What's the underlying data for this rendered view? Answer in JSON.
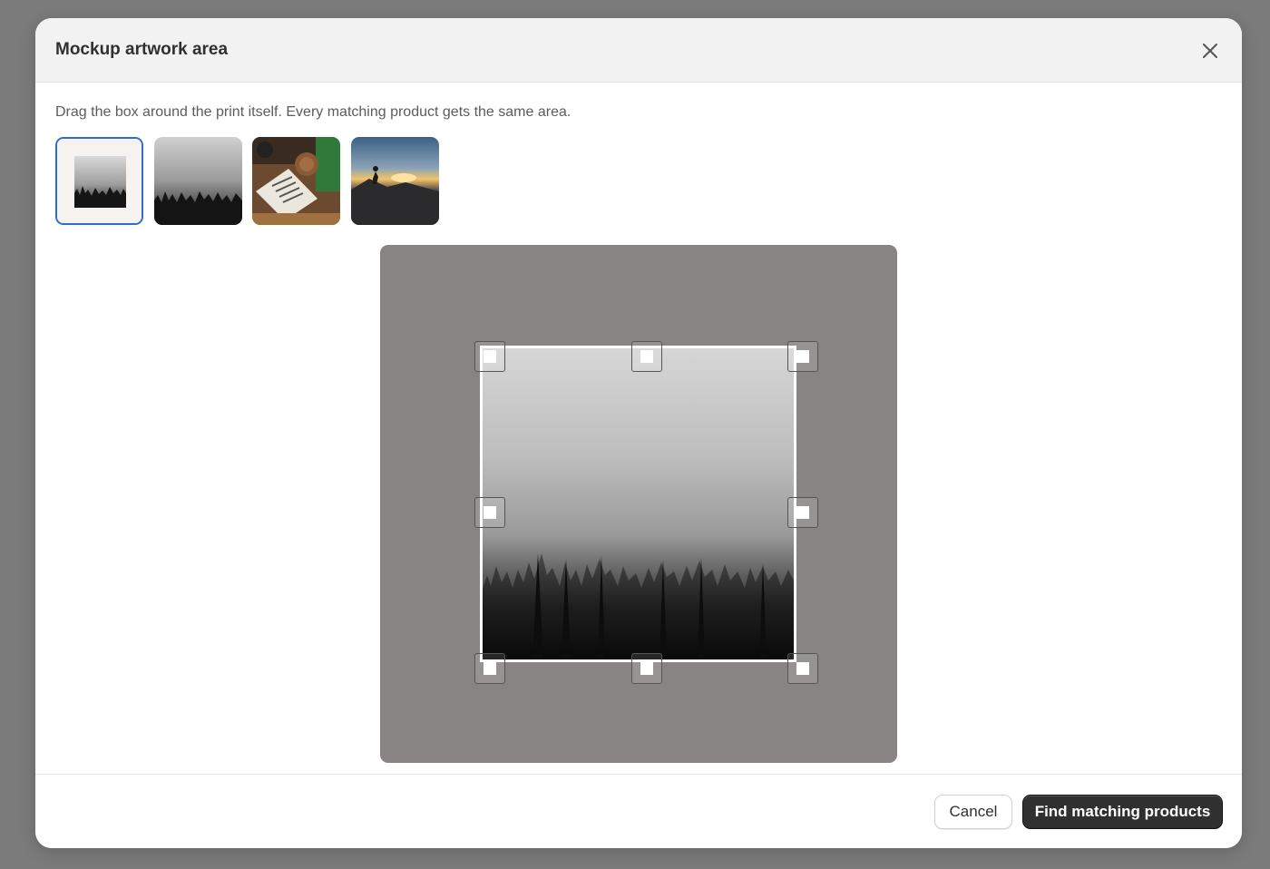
{
  "modal": {
    "title": "Mockup artwork area",
    "close_icon": "close-icon",
    "instructions": "Drag the box around the print itself. Every matching product gets the same area."
  },
  "thumbnails": [
    {
      "name": "framed-forest-print",
      "selected": true
    },
    {
      "name": "misty-forest",
      "selected": false
    },
    {
      "name": "desk-scene-with-book",
      "selected": false
    },
    {
      "name": "mountain-sunset-hiker",
      "selected": false
    }
  ],
  "footer": {
    "cancel_label": "Cancel",
    "primary_label": "Find matching products"
  },
  "colors": {
    "accent": "#2c6ecb",
    "primary_button": "#303030",
    "backdrop": "#7b7b7b",
    "canvas": "#888483"
  }
}
